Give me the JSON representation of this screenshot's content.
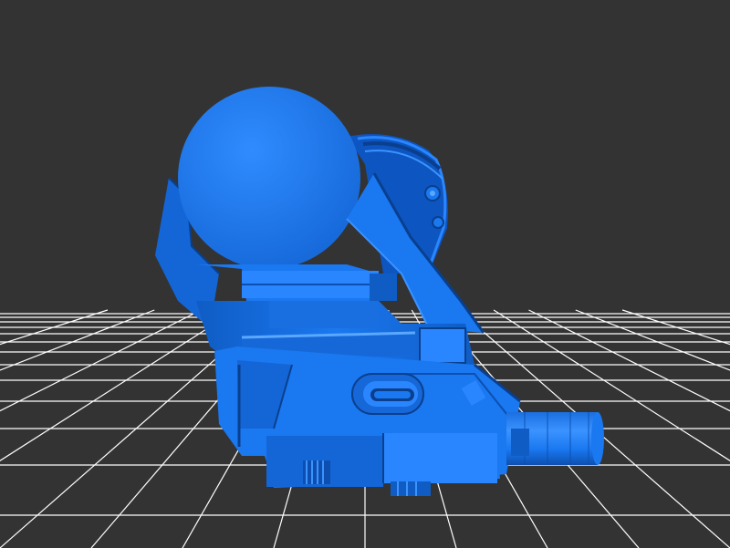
{
  "scene": {
    "background_color": "#333333",
    "grid_color": "#ffffff",
    "model_color": "#1a78f0",
    "model_dark": "#0d4fb0",
    "model_darker": "#0a3f8e",
    "model_light": "#3b93ff",
    "model_highlight": "#5aa8ff",
    "model_description_icon": "3d-model-icon"
  }
}
